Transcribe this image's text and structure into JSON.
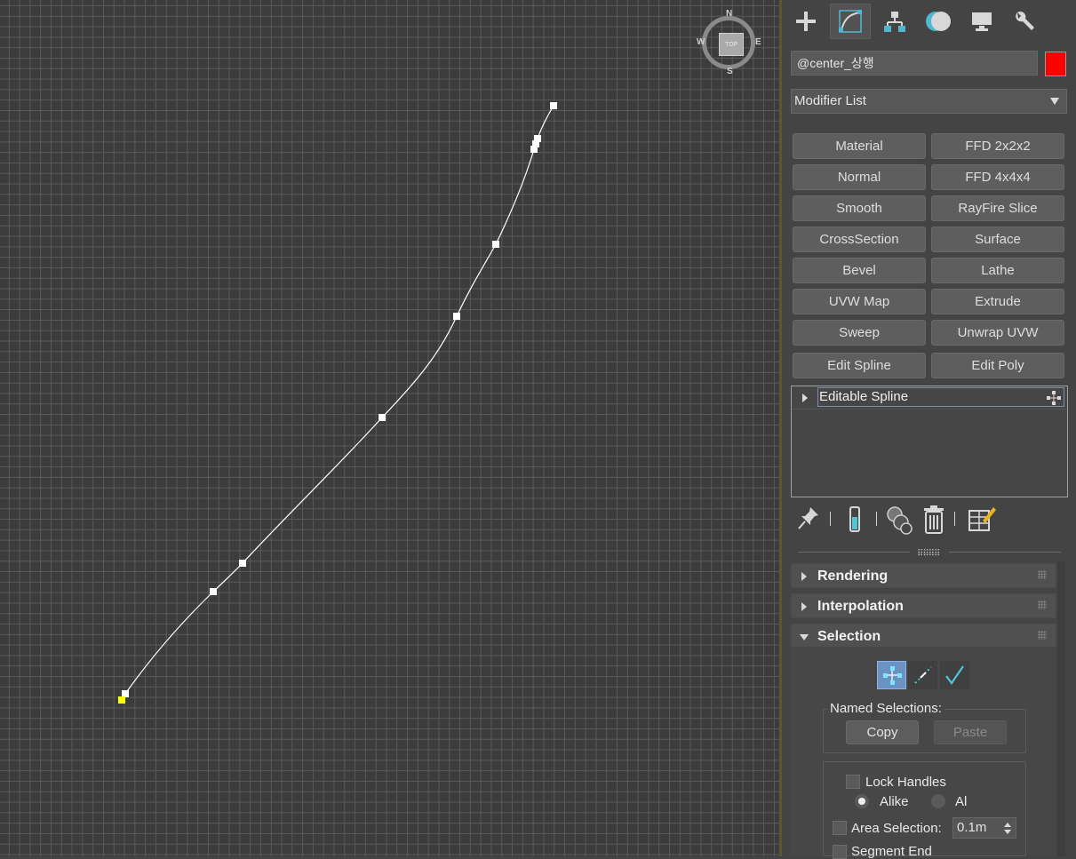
{
  "viewport": {
    "viewcube": {
      "face": "TOP",
      "north": "N",
      "south": "S",
      "east": "E",
      "west": "W"
    }
  },
  "tabs": [
    {
      "name": "create",
      "icon": "plus-icon"
    },
    {
      "name": "modify",
      "icon": "modify-curve-icon",
      "active": true
    },
    {
      "name": "hierarchy",
      "icon": "hierarchy-icon"
    },
    {
      "name": "motion",
      "icon": "motion-icon"
    },
    {
      "name": "display",
      "icon": "display-monitor-icon"
    },
    {
      "name": "utilities",
      "icon": "wrench-icon"
    }
  ],
  "object": {
    "name": "@center_상행",
    "color": "#ff0000"
  },
  "modifier_list": {
    "label": "Modifier List"
  },
  "modifier_buttons": [
    "Material",
    "FFD 2x2x2",
    "Normal",
    "FFD 4x4x4",
    "Smooth",
    "RayFire Slice",
    "CrossSection",
    "Surface",
    "Bevel",
    "Lathe",
    "UVW Map",
    "Extrude",
    "Sweep",
    "Unwrap UVW",
    "Edit Spline",
    "Edit Poly"
  ],
  "stack": {
    "item": "Editable Spline"
  },
  "rollouts": {
    "rendering": "Rendering",
    "interpolation": "Interpolation",
    "selection": "Selection"
  },
  "selection": {
    "modes": [
      "vertex",
      "segment",
      "spline"
    ],
    "active_mode": "vertex",
    "named_selections": "Named Selections:",
    "copy": "Copy",
    "paste": "Paste",
    "lock_handles": "Lock Handles",
    "alike": "Alike",
    "all": "Al",
    "area_selection": "Area Selection:",
    "area_value": "0.1m",
    "segment_end": "Segment End"
  }
}
